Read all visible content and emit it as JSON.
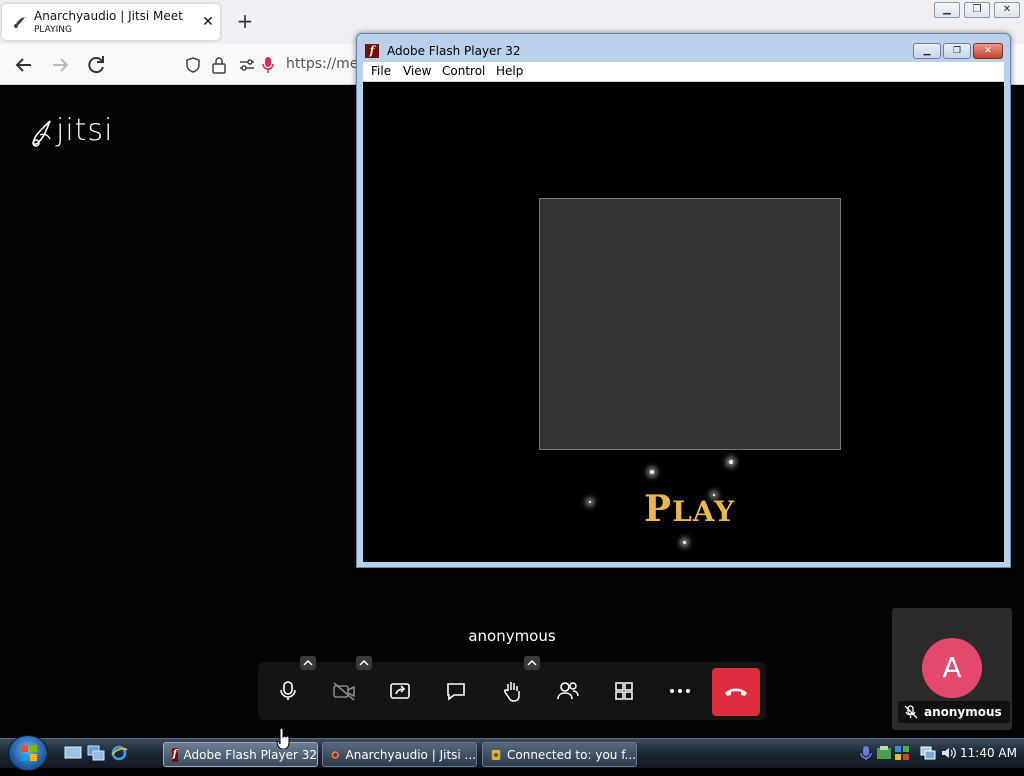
{
  "browser": {
    "tab": {
      "title": "Anarchyaudio | Jitsi Meet",
      "status": "PLAYING"
    },
    "url": "https://meet"
  },
  "page": {
    "logo_text": "jitsi",
    "participant_name": "anonymous",
    "thumbnail": {
      "avatar_letter": "A",
      "name": "anonymous",
      "avatar_color": "#e5486d"
    },
    "hangup_color": "#dd2c3e"
  },
  "flash": {
    "title": "Adobe Flash Player 32",
    "menu": [
      "File",
      "View",
      "Control",
      "Help"
    ],
    "play_first": "P",
    "play_rest": "LAY"
  },
  "taskbar": {
    "tasks": [
      "Adobe Flash Player 32",
      "Anarchyaudio | Jitsi ...",
      "Connected to: you f..."
    ],
    "clock": "11:40 AM"
  }
}
